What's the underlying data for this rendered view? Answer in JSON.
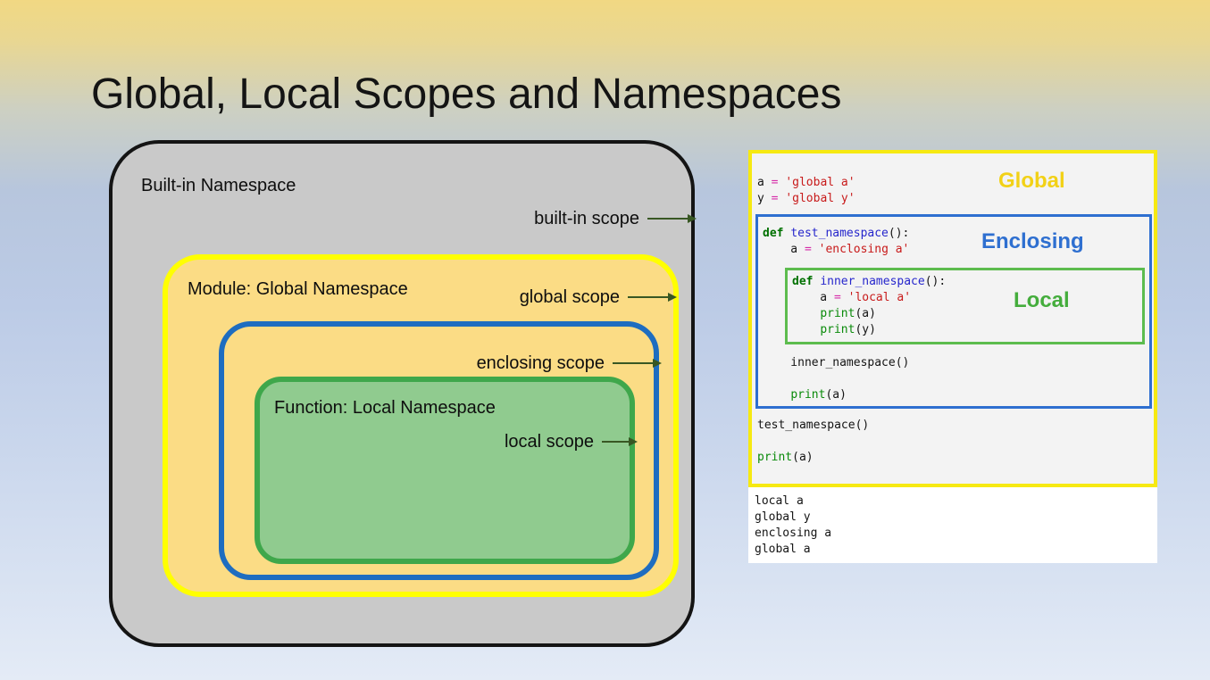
{
  "slide": {
    "title": "Global, Local Scopes and Namespaces"
  },
  "diagram": {
    "builtin_namespace_label": "Built-in Namespace",
    "builtin_scope_label": "built-in scope",
    "global_namespace_label": "Module: Global Namespace",
    "global_scope_label": "global scope",
    "enclosing_scope_label": "enclosing scope",
    "local_namespace_label": "Function: Local Namespace",
    "local_scope_label": "local scope",
    "colors": {
      "builtin_fill": "#c9c9c9",
      "global_fill": "#fbdc85",
      "global_border": "#ffff00",
      "enclosing_border": "#1e6dc0",
      "local_fill": "#90cb8f",
      "local_border": "#3fa74b",
      "arrow": "#385723"
    }
  },
  "code_panel": {
    "labels": {
      "global": "Global",
      "enclosing": "Enclosing",
      "local": "Local"
    },
    "colors": {
      "global_label": "#f2d117",
      "enclosing_label": "#2e6fd0",
      "local_label": "#44ad3c",
      "outer_border": "#f6e912",
      "enclosing_border": "#2e6fd0",
      "local_border": "#5dbc4e"
    },
    "code": {
      "global_top": [
        [
          {
            "t": "a ",
            "c": "plain"
          },
          {
            "t": "= ",
            "c": "op"
          },
          {
            "t": "'global a'",
            "c": "str"
          }
        ],
        [
          {
            "t": "y ",
            "c": "plain"
          },
          {
            "t": "= ",
            "c": "op"
          },
          {
            "t": "'global y'",
            "c": "str"
          }
        ]
      ],
      "enclosing_pre": [
        [
          {
            "t": "def ",
            "c": "kw"
          },
          {
            "t": "test_namespace",
            "c": "fn"
          },
          {
            "t": "():",
            "c": "plain"
          }
        ],
        [
          {
            "t": "    a ",
            "c": "plain"
          },
          {
            "t": "= ",
            "c": "op"
          },
          {
            "t": "'enclosing a'",
            "c": "str"
          }
        ]
      ],
      "local_block": [
        [
          {
            "t": "def ",
            "c": "kw"
          },
          {
            "t": "inner_namespace",
            "c": "fn"
          },
          {
            "t": "():",
            "c": "plain"
          }
        ],
        [
          {
            "t": "    a ",
            "c": "plain"
          },
          {
            "t": "= ",
            "c": "op"
          },
          {
            "t": "'local a'",
            "c": "str"
          }
        ],
        [
          {
            "t": "    ",
            "c": "plain"
          },
          {
            "t": "print",
            "c": "builtin"
          },
          {
            "t": "(a)",
            "c": "plain"
          }
        ],
        [
          {
            "t": "    ",
            "c": "plain"
          },
          {
            "t": "print",
            "c": "builtin"
          },
          {
            "t": "(y)",
            "c": "plain"
          }
        ]
      ],
      "enclosing_post": [
        [
          {
            "t": "    inner_namespace()",
            "c": "plain"
          }
        ],
        [],
        [
          {
            "t": "    ",
            "c": "plain"
          },
          {
            "t": "print",
            "c": "builtin"
          },
          {
            "t": "(a)",
            "c": "plain"
          }
        ]
      ],
      "global_bottom": [
        [
          {
            "t": "test_namespace()",
            "c": "plain"
          }
        ],
        [],
        [
          {
            "t": "print",
            "c": "builtin"
          },
          {
            "t": "(a)",
            "c": "plain"
          }
        ]
      ]
    },
    "output_lines": [
      "local a",
      "global y",
      "enclosing a",
      "global a"
    ]
  }
}
